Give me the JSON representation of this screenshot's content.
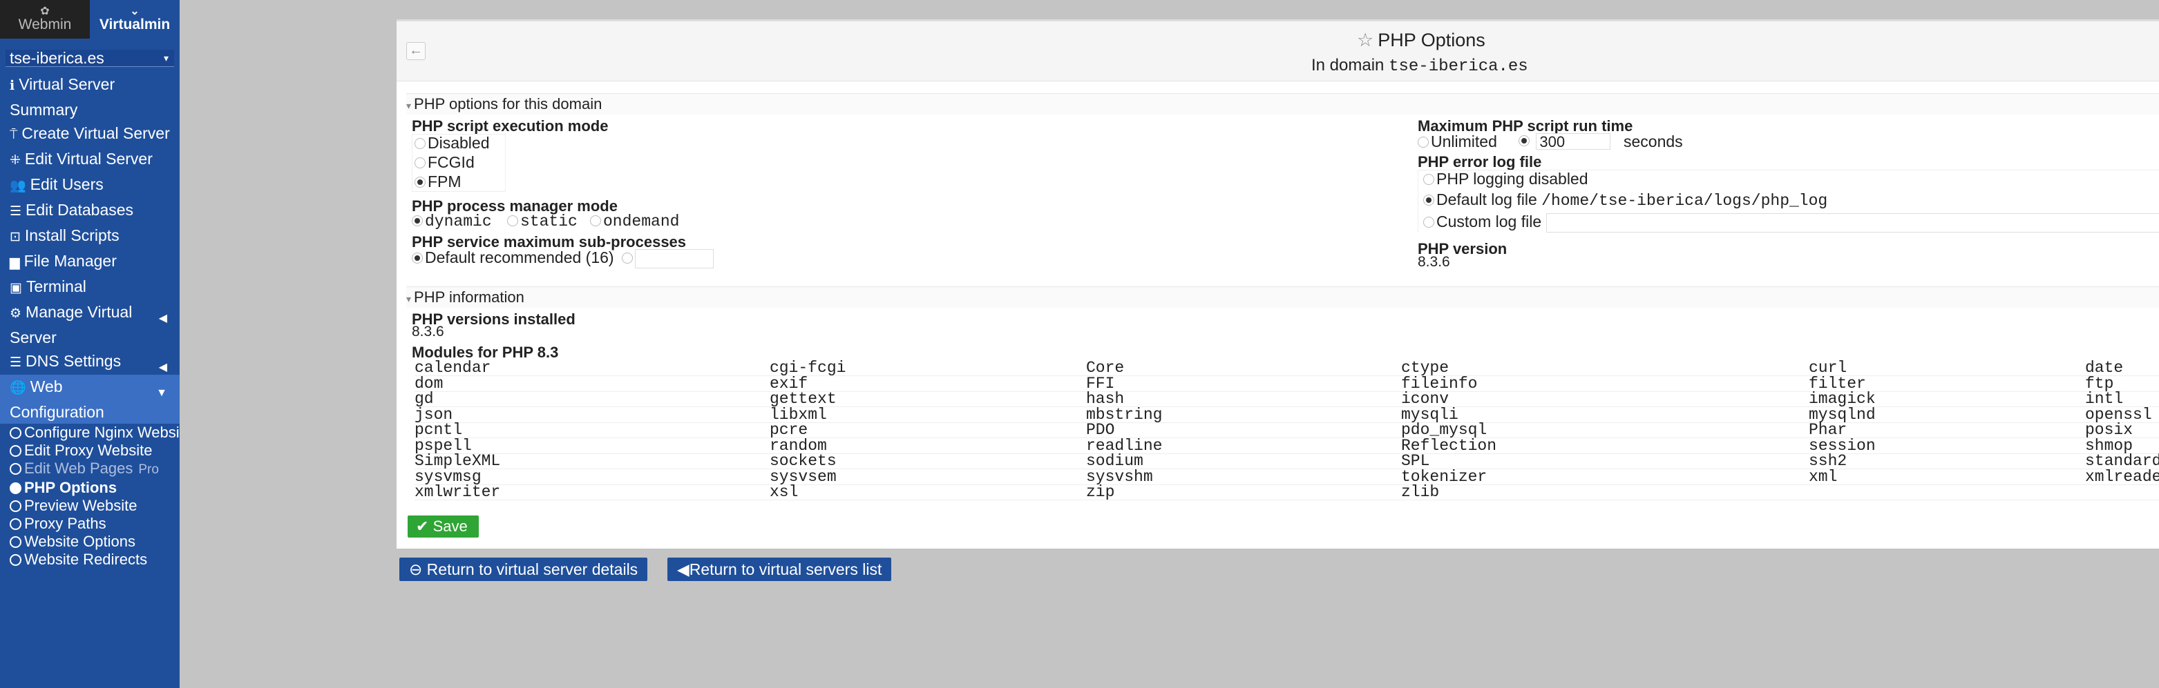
{
  "sidebar": {
    "tabs": {
      "webmin": "Webmin",
      "virtualmin": "Virtualmin"
    },
    "domain_select": "tse-iberica.es",
    "menu": [
      {
        "label": "Virtual Server Summary",
        "icon": "info-icon"
      },
      {
        "label": "Create Virtual Server",
        "icon": "create-icon"
      },
      {
        "label": "Edit Virtual Server",
        "icon": "edit-icon"
      },
      {
        "label": "Edit Users",
        "icon": "users-icon"
      },
      {
        "label": "Edit Databases",
        "icon": "database-icon"
      },
      {
        "label": "Install Scripts",
        "icon": "scripts-icon"
      },
      {
        "label": "File Manager",
        "icon": "folder-icon"
      },
      {
        "label": "Terminal",
        "icon": "terminal-icon"
      },
      {
        "label": "Manage Virtual Server",
        "icon": "gears-icon"
      },
      {
        "label": "DNS Settings",
        "icon": "dns-icon"
      },
      {
        "label": "Web Configuration",
        "icon": "globe-icon"
      }
    ],
    "submenu": [
      {
        "label": "Configure Nginx Website"
      },
      {
        "label": "Edit Proxy Website"
      },
      {
        "label": "Edit Web Pages"
      },
      {
        "label": "PHP Options"
      },
      {
        "label": "Preview Website"
      },
      {
        "label": "Proxy Paths"
      },
      {
        "label": "Website Options"
      },
      {
        "label": "Website Redirects"
      }
    ],
    "overlap_fragment": "Pro"
  },
  "header": {
    "title": "PHP Options",
    "subtitle_prefix": "In domain",
    "domain": "tse-iberica.es"
  },
  "php_options": {
    "section_title": "PHP options for this domain",
    "exec_mode": {
      "label": "PHP script execution mode",
      "options": [
        "Disabled",
        "FCGId",
        "FPM"
      ],
      "selected": "FPM"
    },
    "pm_mode": {
      "label": "PHP process manager mode",
      "options": [
        "dynamic",
        "static",
        "ondemand"
      ],
      "selected": "dynamic"
    },
    "max_sub": {
      "label": "PHP service maximum sub-processes",
      "option": "Default recommended (16)",
      "custom_value": ""
    },
    "max_run": {
      "label": "Maximum PHP script run time",
      "unlimited": "Unlimited",
      "value": "300",
      "unit": "seconds"
    },
    "error_log": {
      "label": "PHP error log file",
      "disabled": "PHP logging disabled",
      "default_label": "Default log file",
      "default_path": "/home/tse-iberica/logs/php_log",
      "custom": "Custom log file",
      "custom_value": ""
    },
    "version": {
      "label": "PHP version",
      "value": "8.3.6"
    }
  },
  "php_info": {
    "section_title": "PHP information",
    "installed_label": "PHP versions installed",
    "installed_value": "8.3.6",
    "modules_label": "Modules for PHP 8.3",
    "modules": [
      [
        "calendar",
        "cgi-fcgi",
        "Core",
        "ctype",
        "curl",
        "date"
      ],
      [
        "dom",
        "exif",
        "FFI",
        "fileinfo",
        "filter",
        "ftp"
      ],
      [
        "gd",
        "gettext",
        "hash",
        "iconv",
        "imagick",
        "intl"
      ],
      [
        "json",
        "libxml",
        "mbstring",
        "mysqli",
        "mysqlnd",
        "openssl"
      ],
      [
        "pcntl",
        "pcre",
        "PDO",
        "pdo_mysql",
        "Phar",
        "posix"
      ],
      [
        "pspell",
        "random",
        "readline",
        "Reflection",
        "session",
        "shmop"
      ],
      [
        "SimpleXML",
        "sockets",
        "sodium",
        "SPL",
        "ssh2",
        "standard"
      ],
      [
        "sysvmsg",
        "sysvsem",
        "sysvshm",
        "tokenizer",
        "xml",
        "xmlreader"
      ],
      [
        "xmlwriter",
        "xsl",
        "zip",
        "zlib",
        "",
        ""
      ]
    ]
  },
  "buttons": {
    "save": "Save",
    "return_details": "Return to virtual server details",
    "return_list": "Return to virtual servers list"
  },
  "colors": {
    "sidebar_bg": "#1f4f9b",
    "save_green": "#2ea534",
    "button_blue": "#1f4f9b"
  }
}
